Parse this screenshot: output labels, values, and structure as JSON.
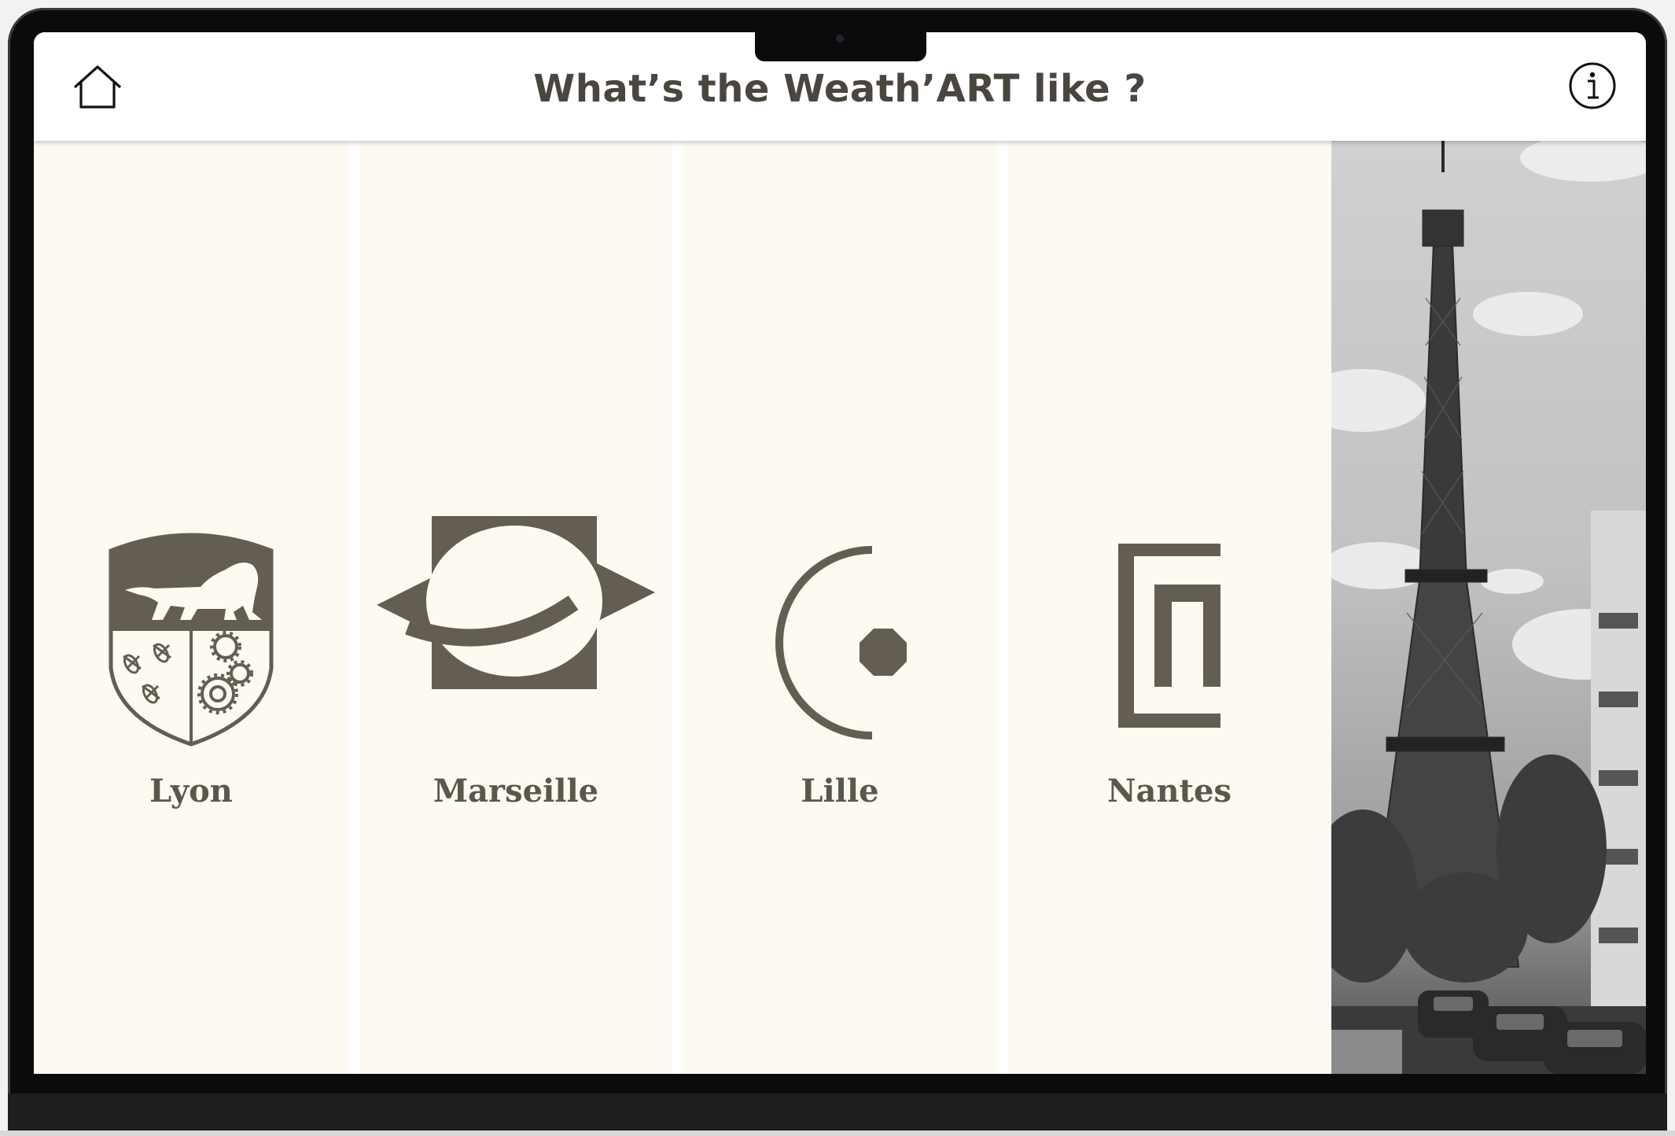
{
  "header": {
    "title": "What’s the Weath’ART like ?",
    "home_icon": "home-icon",
    "info_icon": "info-icon"
  },
  "cities": [
    {
      "name": "Lyon",
      "icon": "lyon-crest-icon"
    },
    {
      "name": "Marseille",
      "icon": "marseille-logo-icon"
    },
    {
      "name": "Lille",
      "icon": "lille-logo-icon"
    },
    {
      "name": "Nantes",
      "icon": "nantes-logo-icon"
    }
  ],
  "photo": {
    "subject": "eiffel-tower-photo"
  },
  "colors": {
    "panel_background": "#fdfaf2",
    "logo_color": "#635d52",
    "title_color": "#4a463f",
    "label_color": "#5d564b"
  }
}
